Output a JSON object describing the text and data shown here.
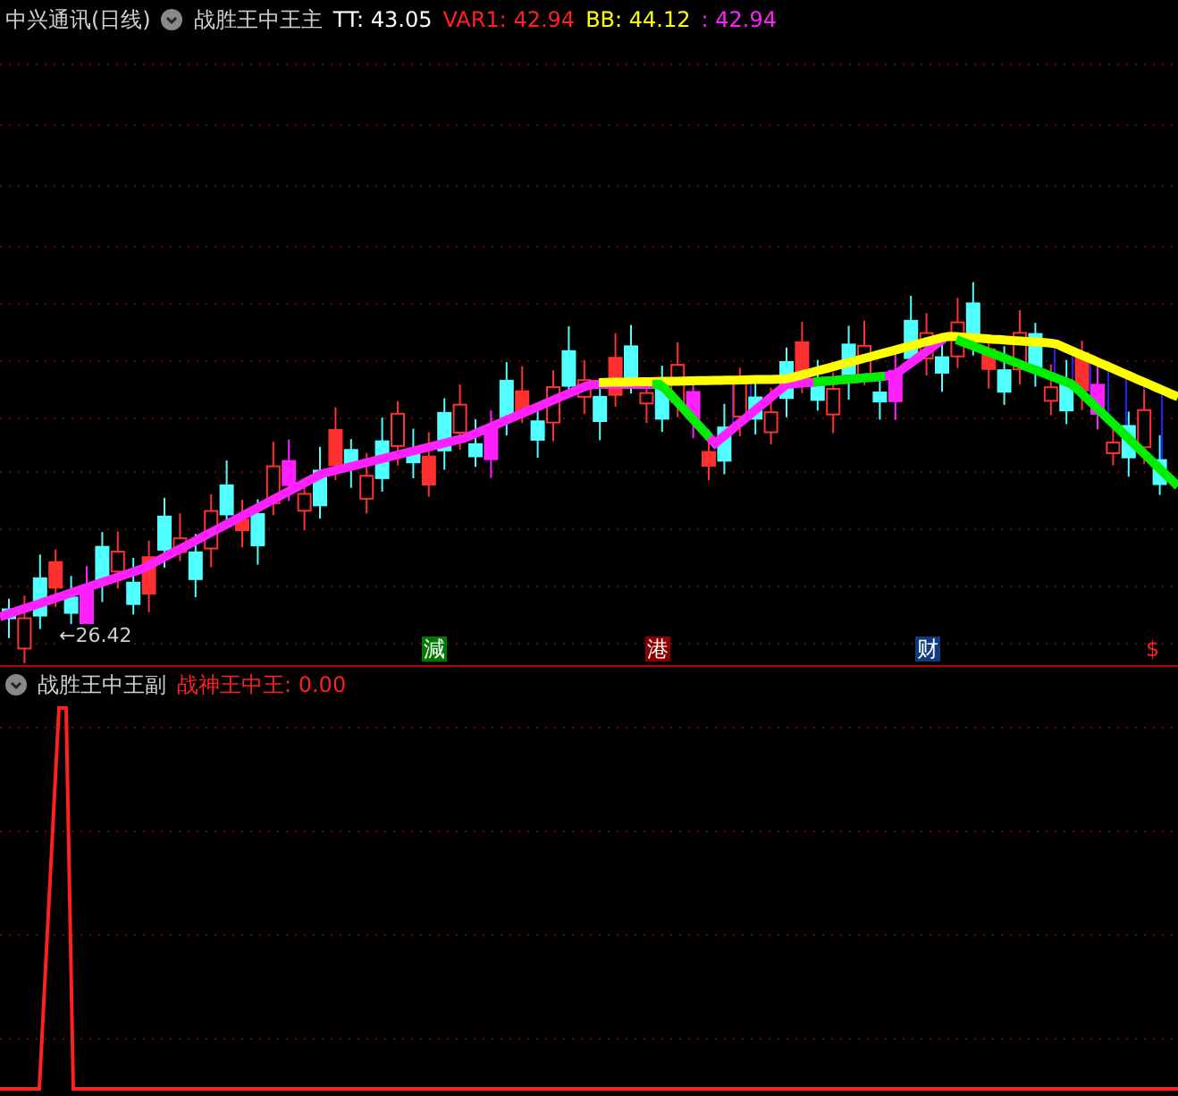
{
  "main_header": {
    "stock": "中兴通讯(日线)",
    "indicator": "战胜王中王主",
    "values": [
      {
        "label": "TT: 43.05",
        "color": "#ffffff"
      },
      {
        "label": "VAR1: 42.94",
        "color": "#ff2020"
      },
      {
        "label": "BB: 44.12",
        "color": "#ffff00"
      },
      {
        "label": ": 42.94",
        "color": "#ff20ff"
      }
    ]
  },
  "low_label": "←26.42",
  "markers": [
    {
      "text": "減",
      "kind": "badge",
      "color": "#007a00"
    },
    {
      "text": "港",
      "kind": "badge",
      "color": "#8a0000"
    },
    {
      "text": "财",
      "kind": "badge",
      "color": "#103a7a"
    },
    {
      "text": "$",
      "kind": "plain",
      "color": "#ff2020"
    }
  ],
  "sub_header": {
    "indicator": "战胜王中王副",
    "values": [
      {
        "label": "战神王中王: 0.00",
        "color": "#ff2020"
      }
    ]
  }
}
